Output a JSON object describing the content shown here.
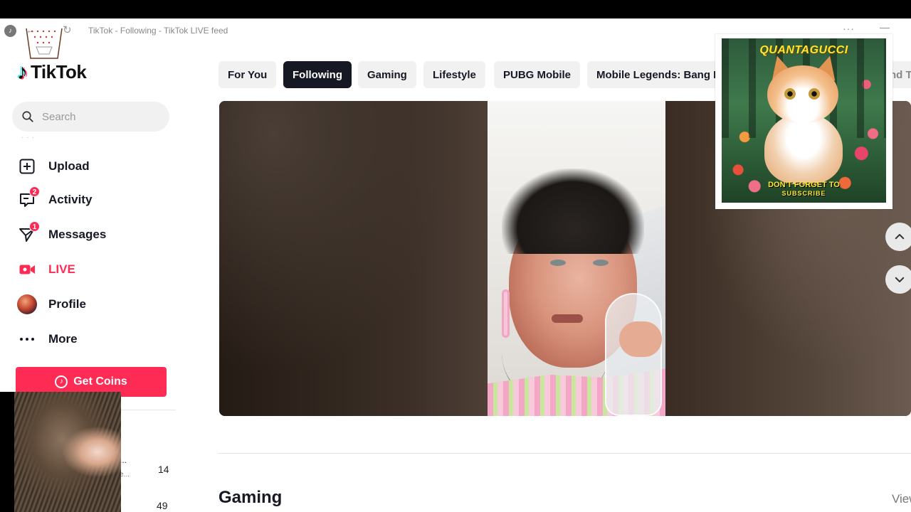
{
  "titlebar": {
    "text": "TikTok - Following - TikTok LIVE feed",
    "menu_glyph": "···",
    "minimize_glyph": "—"
  },
  "brand": {
    "name": "TikTok"
  },
  "search": {
    "placeholder": "Search"
  },
  "sidebar": {
    "items": [
      {
        "label": "Upload",
        "icon": "plus-square-icon"
      },
      {
        "label": "Activity",
        "icon": "activity-icon",
        "badge": "2"
      },
      {
        "label": "Messages",
        "icon": "paper-plane-icon",
        "badge": "1"
      },
      {
        "label": "LIVE",
        "icon": "live-camera-icon"
      },
      {
        "label": "Profile",
        "icon": "avatar"
      },
      {
        "label": "More",
        "icon": "more-dots-icon"
      }
    ],
    "coins_button": "Get Coins"
  },
  "stats": {
    "dots": "...",
    "dots2": "e...",
    "first": "14",
    "second": "49"
  },
  "tabs": [
    {
      "label": "For You",
      "active": false
    },
    {
      "label": "Following",
      "active": true
    },
    {
      "label": "Gaming",
      "active": false
    },
    {
      "label": "Lifestyle",
      "active": false
    },
    {
      "label": "PUBG Mobile",
      "active": false
    },
    {
      "label": "Mobile Legends: Bang B",
      "active": false
    },
    {
      "label": "nd T",
      "active": false
    }
  ],
  "promo": {
    "title": "QUANTAGUCCI",
    "line1": "DON'T FORGET TO",
    "line2": "SUBSCRIBE"
  },
  "section": {
    "title": "Gaming",
    "view_all": "View"
  },
  "colors": {
    "accent": "#fe2c55",
    "active_tab": "#161823",
    "tab_bg": "#f1f1f2"
  }
}
